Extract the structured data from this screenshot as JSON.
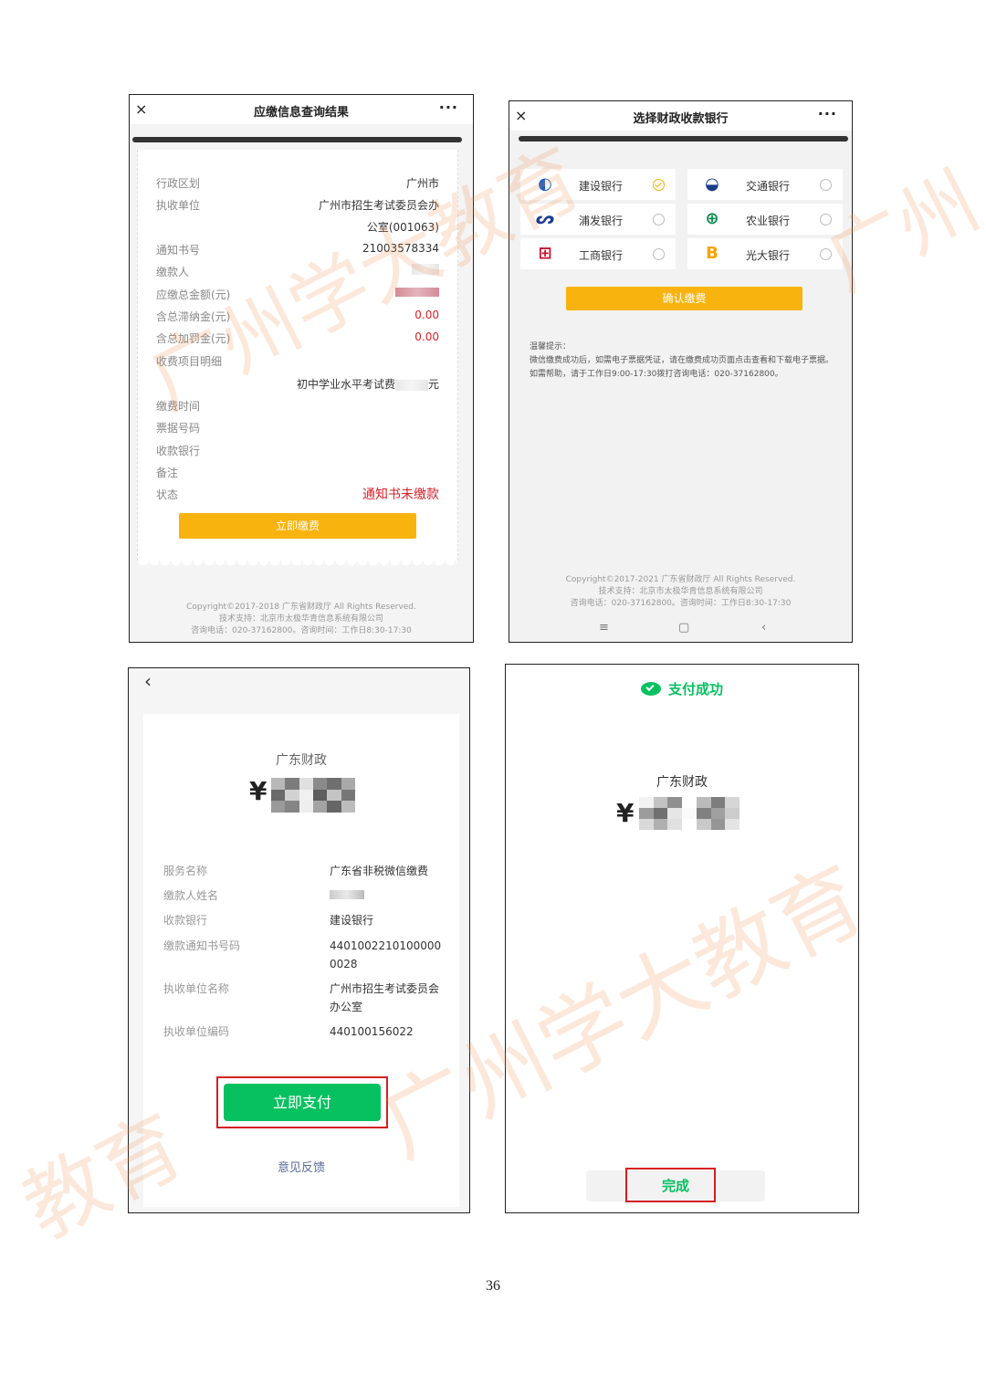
{
  "panel1": {
    "title": "应缴信息查询结果",
    "close_icon": "×",
    "more_icon": "···",
    "rows": [
      {
        "key": "行政区划",
        "value": "广州市"
      },
      {
        "key": "执收单位",
        "value": "广州市招生考试委员会办"
      },
      {
        "key": "",
        "value": "公室(001063)"
      },
      {
        "key": "通知书号",
        "value": "21003578334"
      },
      {
        "key": "缴款人",
        "value": ""
      },
      {
        "key": "应缴总金额(元)",
        "value": ""
      },
      {
        "key": "含总滞纳金(元)",
        "value": "0.00"
      },
      {
        "key": "含总加罚金(元)",
        "value": "0.00"
      },
      {
        "key": "收费项目明细",
        "value": ""
      }
    ],
    "fee_item_prefix": "初中学业水平考试费",
    "fee_item_suffix": "元",
    "rows2": [
      {
        "key": "缴费时间",
        "value": ""
      },
      {
        "key": "票据号码",
        "value": ""
      },
      {
        "key": "收款银行",
        "value": ""
      },
      {
        "key": "备注",
        "value": ""
      },
      {
        "key": "状态",
        "value": "通知书未缴款"
      }
    ],
    "pay_button": "立即缴费",
    "footer": [
      "Copyright©2017-2018 广东省财政厅 All Rights Reserved.",
      "技术支持：北京市太极华青信息系统有限公司",
      "咨询电话：020-37162800。咨询时间：工作日8:30-17:30"
    ]
  },
  "panel2": {
    "title": "选择财政收款银行",
    "close_icon": "×",
    "more_icon": "···",
    "banks": [
      {
        "name": "建设银行",
        "selected": true,
        "icon": "ccb-logo-icon",
        "color": "#1c5fc4"
      },
      {
        "name": "交通银行",
        "selected": false,
        "icon": "bocom-logo-icon",
        "color": "#1a3e8c"
      },
      {
        "name": "浦发银行",
        "selected": false,
        "icon": "spdb-logo-icon",
        "color": "#1d3c8f"
      },
      {
        "name": "农业银行",
        "selected": false,
        "icon": "abc-logo-icon",
        "color": "#0a8a4e"
      },
      {
        "name": "工商银行",
        "selected": false,
        "icon": "icbc-logo-icon",
        "color": "#c8102e"
      },
      {
        "name": "光大银行",
        "selected": false,
        "icon": "ceb-logo-icon",
        "color": "#f5a300"
      }
    ],
    "confirm_button": "确认缴费",
    "tips_title": "温馨提示：",
    "tips_body": "微信缴费成功后，如需电子票据凭证，请在缴费成功页面点击查看和下载电子票据。如需帮助，请于工作日9:00-17:30拨打咨询电话：020-37162800。",
    "footer": [
      "Copyright©2017-2021 广东省财政厅 All Rights Reserved.",
      "技术支持：北京市太极华青信息系统有限公司",
      "咨询电话：020-37162800。咨询时间：工作日8:30-17:30"
    ],
    "nav": [
      "≡",
      "▢",
      "‹"
    ]
  },
  "panel3": {
    "back_icon": "‹",
    "merchant": "广东财政",
    "currency": "¥",
    "rows": [
      {
        "key": "服务名称",
        "value": "广东省非税微信缴费"
      },
      {
        "key": "缴款人姓名",
        "value": ""
      },
      {
        "key": "收款银行",
        "value": "建设银行"
      },
      {
        "key": "缴款通知书号码",
        "value": "4401002210100000 0028"
      },
      {
        "key": "执收单位名称",
        "value": "广州市招生考试委员会办公室"
      },
      {
        "key": "执收单位编码",
        "value": "440100156022"
      }
    ],
    "pay_button": "立即支付",
    "feedback": "意见反馈"
  },
  "panel4": {
    "success_text": "支付成功",
    "merchant": "广东财政",
    "currency": "¥",
    "done_button": "完成"
  },
  "watermark": "广州学大教育",
  "page_number": "36",
  "colors": {
    "wechat_green": "#07c160",
    "payment_yellow": "#f9b30e",
    "alert_red": "#d8202a",
    "highlight_red": "#d42020"
  }
}
